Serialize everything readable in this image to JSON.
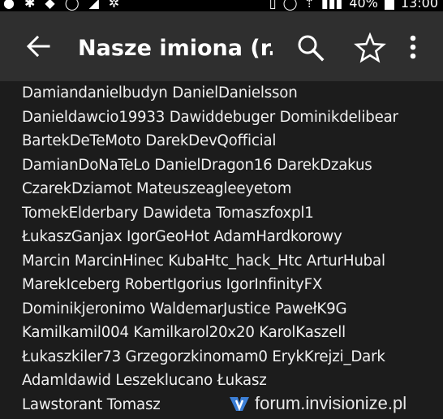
{
  "status_bar": {
    "icons": [
      "notification-icon",
      "whatsapp-icon",
      "messenger-icon",
      "vpn-icon",
      "lte-icon",
      "alarm-icon",
      "wifi-icon",
      "signal-icon",
      "battery-icon"
    ],
    "battery_percent": "40%",
    "time": "13:00"
  },
  "app_bar": {
    "title": "Nasze imiona (r...",
    "icons": [
      "back-arrow-icon",
      "search-icon",
      "star-icon",
      "more-vert-icon"
    ]
  },
  "names": [
    "Damiandanielbudyn DanielDanielsson",
    "Danieldawcio19933 Dawiddebuger Dominikdelibear",
    "BartekDeTeMoto DarekDevQofficial",
    "DamianDoNaTeLo DanielDragon16 DarekDzakus",
    "CzarekDziamot Mateuszeagleeyetom",
    "TomekElderbary Dawideta Tomaszfoxpl1",
    "ŁukaszGanjax IgorGeoHot AdamHardkorowy",
    "Marcin MarcinHinec KubaHtc_hack_Htc ArturHubal",
    "MarekIceberg RobertIgorius IgorInfinityFX",
    "Dominikjeronimo WaldemarJustice PawełK9G",
    "Kamilkamil004 Kamilkarol20x20 KarolKaszell",
    "Łukaszkiler73 Grzegorzkinomam0 ErykKrejzi_Dark",
    "Adamldawid Leszeklucano Łukasz",
    "Lawstorant Tomasz"
  ],
  "watermark": {
    "text": "forum.invisionize.pl",
    "logo_icon": "invisionize-logo-icon"
  }
}
